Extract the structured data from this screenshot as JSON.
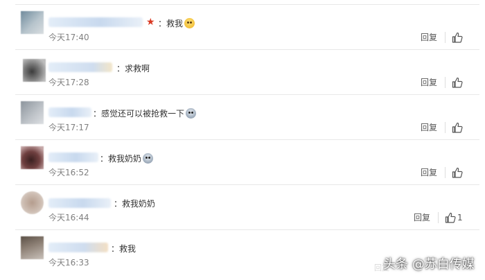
{
  "comments": [
    {
      "text": "：救我",
      "time": "今天17:40",
      "reply": "回复",
      "likes": "",
      "badge": "★",
      "emoji": "smiling-face-emoji"
    },
    {
      "text": "：求救啊",
      "time": "今天17:28",
      "reply": "回复",
      "likes": ""
    },
    {
      "text": "：感觉还可以被抢救一下",
      "time": "今天17:17",
      "reply": "回复",
      "likes": "",
      "emoji": "scared-face-emoji"
    },
    {
      "text": "：救我奶奶",
      "time": "今天16:52",
      "reply": "回复",
      "likes": "",
      "emoji": "scared-face-emoji"
    },
    {
      "text": "：救我奶奶",
      "time": "今天16:44",
      "reply": "回复",
      "likes": "1"
    },
    {
      "text": "：救我",
      "time": "今天16:33",
      "reply": "",
      "likes": ""
    }
  ],
  "watermark": "头条 @苏白传媒",
  "bg_partial_text": "回复",
  "colors": {
    "badge": "#d93a24",
    "time": "#808080",
    "text": "#333333"
  }
}
